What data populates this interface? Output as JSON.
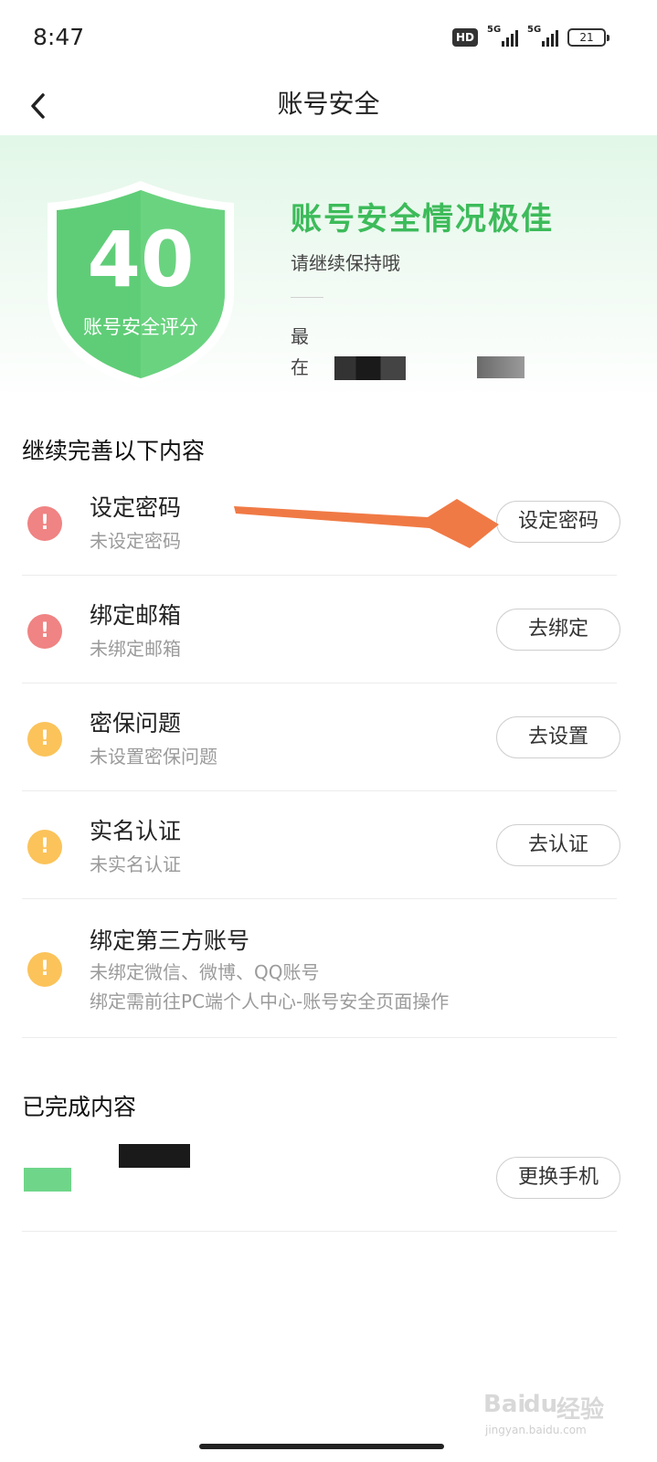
{
  "status": {
    "time": "8:47",
    "hd": "HD",
    "net1": "5G",
    "net2": "5G",
    "battery": "21"
  },
  "nav": {
    "title": "账号安全"
  },
  "hero": {
    "score": "40",
    "score_label": "账号安全评分",
    "title": "账号安全情况极佳",
    "subtitle": "请继续保持哦",
    "line1": "最",
    "line2": "在"
  },
  "todo": {
    "title": "继续完善以下内容",
    "items": [
      {
        "title": "设定密码",
        "desc": "未设定密码",
        "button": "设定密码",
        "status": "red"
      },
      {
        "title": "绑定邮箱",
        "desc": "未绑定邮箱",
        "button": "去绑定",
        "status": "red"
      },
      {
        "title": "密保问题",
        "desc": "未设置密保问题",
        "button": "去设置",
        "status": "yellow"
      },
      {
        "title": "实名认证",
        "desc": "未实名认证",
        "button": "去认证",
        "status": "yellow"
      },
      {
        "title": "绑定第三方账号",
        "desc": "未绑定微信、微博、QQ账号",
        "desc2": "绑定需前往PC端个人中心-账号安全页面操作",
        "status": "yellow"
      }
    ]
  },
  "done": {
    "title": "已完成内容",
    "items": [
      {
        "button": "更换手机"
      }
    ]
  },
  "icons": {
    "warning": "!"
  },
  "colors": {
    "accent": "#3dbb5a",
    "shield": "#5fcd77",
    "red": "#f08383",
    "yellow": "#fbc35a",
    "arrow": "#f07a45"
  },
  "watermark": {
    "text1": "Bai",
    "text2": "du",
    "text3": "经验",
    "text4": "jingyan.baidu.com"
  }
}
